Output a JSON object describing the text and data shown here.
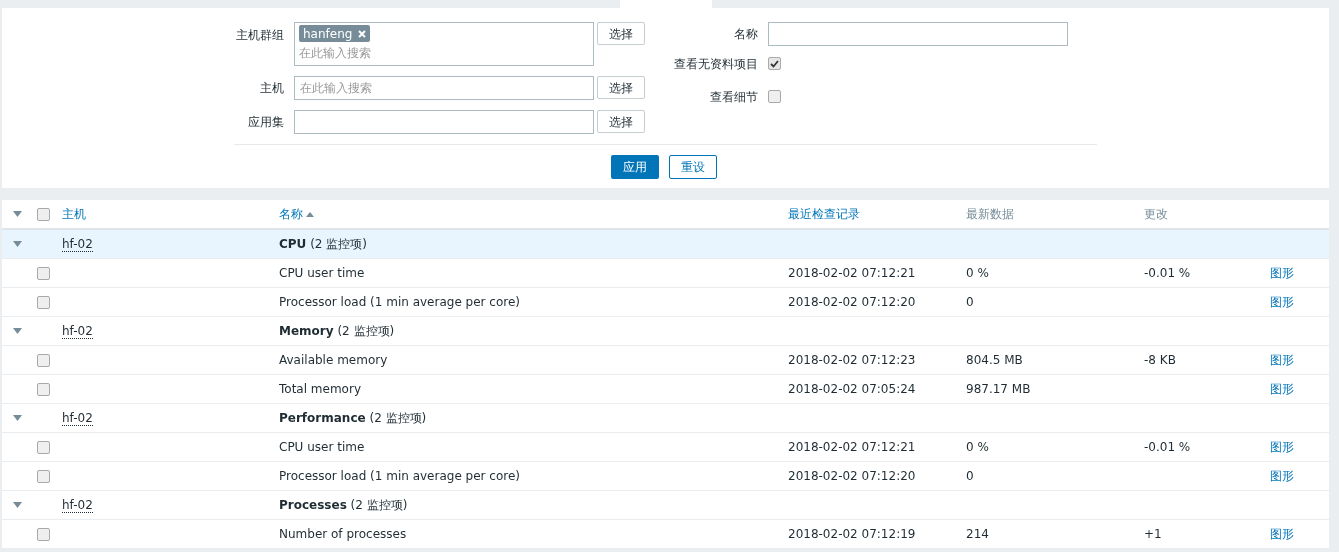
{
  "filter": {
    "host_groups": {
      "label": "主机群组",
      "tags": [
        "hanfeng"
      ],
      "placeholder": "在此输入搜索",
      "button": "选择"
    },
    "hosts": {
      "label": "主机",
      "placeholder": "在此输入搜索",
      "button": "选择"
    },
    "application": {
      "label": "应用集",
      "button": "选择"
    },
    "name": {
      "label": "名称"
    },
    "show_without_data": {
      "label": "查看无资料项目",
      "checked": true
    },
    "show_details": {
      "label": "查看细节",
      "checked": false
    },
    "apply": "应用",
    "reset": "重设"
  },
  "table": {
    "all_checked": false,
    "columns": [
      {
        "label": "主机",
        "link": true,
        "sorted": false
      },
      {
        "label": "名称",
        "link": true,
        "sorted": true
      },
      {
        "label": "最近检查记录",
        "link": true,
        "sorted": false
      },
      {
        "label": "最新数据",
        "link": false,
        "sorted": false
      },
      {
        "label": "更改",
        "link": false,
        "sorted": false
      }
    ],
    "groups": [
      {
        "host": "hf-02",
        "name": "CPU",
        "count": "(2 监控项)",
        "expanded": true,
        "highlighted": true,
        "items": [
          {
            "name": "CPU user time",
            "checked": false,
            "last_check": "2018-02-02 07:12:21",
            "last_value": "0 %",
            "change": "-0.01 %",
            "action": "图形"
          },
          {
            "name": "Processor load (1 min average per core)",
            "checked": false,
            "last_check": "2018-02-02 07:12:20",
            "last_value": "0",
            "action": "图形"
          }
        ]
      },
      {
        "host": "hf-02",
        "name": "Memory",
        "count": "(2 监控项)",
        "expanded": true,
        "highlighted": false,
        "items": [
          {
            "name": "Available memory",
            "checked": false,
            "last_check": "2018-02-02 07:12:23",
            "last_value": "804.5 MB",
            "change": "-8 KB",
            "action": "图形"
          },
          {
            "name": "Total memory",
            "checked": false,
            "last_check": "2018-02-02 07:05:24",
            "last_value": "987.17 MB",
            "action": "图形"
          }
        ]
      },
      {
        "host": "hf-02",
        "name": "Performance",
        "count": "(2 监控项)",
        "expanded": true,
        "highlighted": false,
        "items": [
          {
            "name": "CPU user time",
            "checked": false,
            "last_check": "2018-02-02 07:12:21",
            "last_value": "0 %",
            "change": "-0.01 %",
            "action": "图形"
          },
          {
            "name": "Processor load (1 min average per core)",
            "checked": false,
            "last_check": "2018-02-02 07:12:20",
            "last_value": "0",
            "action": "图形"
          }
        ]
      },
      {
        "host": "hf-02",
        "name": "Processes",
        "count": "(2 监控项)",
        "expanded": true,
        "highlighted": false,
        "items": [
          {
            "name": "Number of processes",
            "checked": false,
            "last_check": "2018-02-02 07:12:19",
            "last_value": "214",
            "change": "+1",
            "action": "图形"
          }
        ]
      }
    ]
  }
}
